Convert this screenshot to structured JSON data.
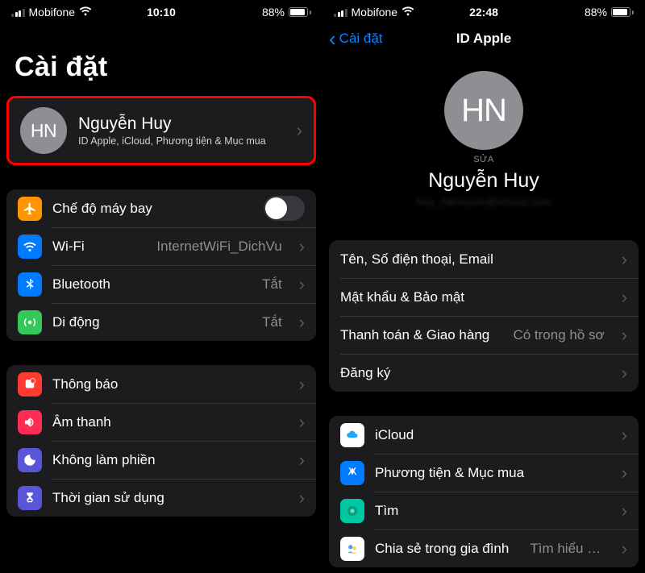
{
  "left": {
    "status": {
      "carrier": "Mobifone",
      "time": "10:10",
      "battery": "88%"
    },
    "title": "Cài đặt",
    "profile": {
      "initials": "HN",
      "name": "Nguyễn Huy",
      "sub": "ID Apple, iCloud, Phương tiện & Mục mua"
    },
    "group1": {
      "airplane": "Chế độ máy bay",
      "wifi": {
        "label": "Wi-Fi",
        "value": "InternetWiFi_DichVu"
      },
      "bluetooth": {
        "label": "Bluetooth",
        "value": "Tắt"
      },
      "cellular": {
        "label": "Di động",
        "value": "Tắt"
      }
    },
    "group2": {
      "notifications": "Thông báo",
      "sounds": "Âm thanh",
      "dnd": "Không làm phiền",
      "screentime": "Thời gian sử dụng"
    }
  },
  "right": {
    "status": {
      "carrier": "Mobifone",
      "time": "22:48",
      "battery": "88%"
    },
    "back": "Cài đặt",
    "title": "ID Apple",
    "profile": {
      "initials": "HN",
      "edit": "SỬA",
      "name": "Nguyễn Huy",
      "email_masked": "huy_nikhuyuh@icloud.com"
    },
    "group1": {
      "name_phone": "Tên, Số điện thoại, Email",
      "password": "Mật khẩu & Bảo mật",
      "payment": {
        "label": "Thanh toán & Giao hàng",
        "value": "Có trong hồ sơ"
      },
      "subscriptions": "Đăng ký"
    },
    "group2": {
      "icloud": "iCloud",
      "media": "Phương tiện & Mục mua",
      "find": "Tìm",
      "family": {
        "label": "Chia sẻ trong gia đình",
        "value": "Tìm hiểu th..."
      }
    }
  }
}
